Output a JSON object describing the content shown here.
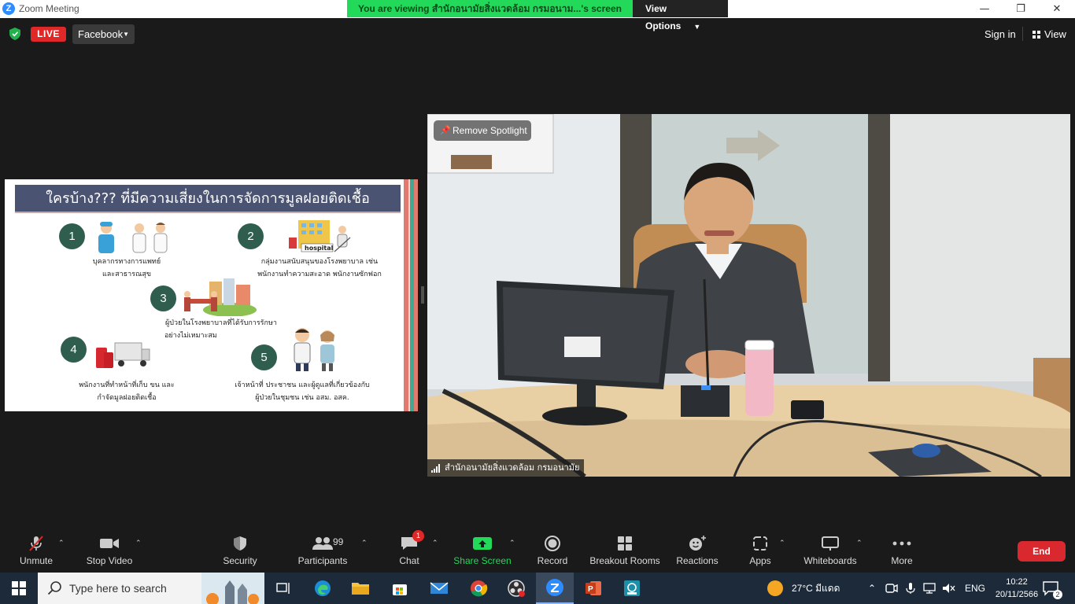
{
  "window": {
    "title": "Zoom Meeting",
    "app_icon": "Z"
  },
  "banner": {
    "message": "You are viewing สำนักอนามัยสิ่งแวดล้อม กรมอนาม...'s screen",
    "view_options": "View Options"
  },
  "topbar": {
    "live_label": "LIVE",
    "stream_target": "Facebook",
    "sign_in": "Sign in",
    "view": "View"
  },
  "slide": {
    "title": "ใครบ้าง??? ที่มีความเสี่ยงในการจัดการมูลฝอยติดเชื้อ",
    "items": [
      {
        "num": "1",
        "line1": "บุคลากรทางการแพทย์",
        "line2": "และสาธารณสุข"
      },
      {
        "num": "2",
        "line1": "กลุ่มงานสนับสนุนของโรงพยาบาล เช่น",
        "line2": "พนักงานทำความสะอาด พนักงานซักฟอก"
      },
      {
        "num": "3",
        "line1": "ผู้ป่วยในโรงพยาบาลที่ได้รับการรักษา",
        "line2": "อย่างไม่เหมาะสม"
      },
      {
        "num": "4",
        "line1": "พนักงานที่ทำหน้าที่เก็บ ขน และ",
        "line2": "กำจัดมูลฝอยติดเชื้อ"
      },
      {
        "num": "5",
        "line1": "เจ้าหน้าที่ ประชาชน และผู้ดูแลที่เกี่ยวข้องกับ",
        "line2": "ผู้ป่วยในชุมชน เช่น อสม. อสค."
      }
    ],
    "hospital_sign": "hospital"
  },
  "video": {
    "remove_spotlight": "Remove Spotlight",
    "participant_name": "สำนักอนามัยสิ่งแวดล้อม กรมอนามัย"
  },
  "toolbar": {
    "unmute": "Unmute",
    "stop_video": "Stop Video",
    "security": "Security",
    "participants": "Participants",
    "participants_count": "99",
    "chat": "Chat",
    "chat_badge": "1",
    "share_screen": "Share Screen",
    "record": "Record",
    "breakout_rooms": "Breakout Rooms",
    "reactions": "Reactions",
    "apps": "Apps",
    "whiteboards": "Whiteboards",
    "more": "More",
    "end": "End"
  },
  "taskbar": {
    "search_placeholder": "Type here to search",
    "weather": "27°C  มีแดด",
    "language": "ENG",
    "time": "10:22",
    "date": "20/11/2566",
    "notification_count": "2"
  },
  "colors": {
    "live_red": "#e02828",
    "banner_green": "#23d959",
    "end_red": "#d9282e",
    "slide_header": "#4a5372",
    "step_circle": "#2f5e4f"
  }
}
